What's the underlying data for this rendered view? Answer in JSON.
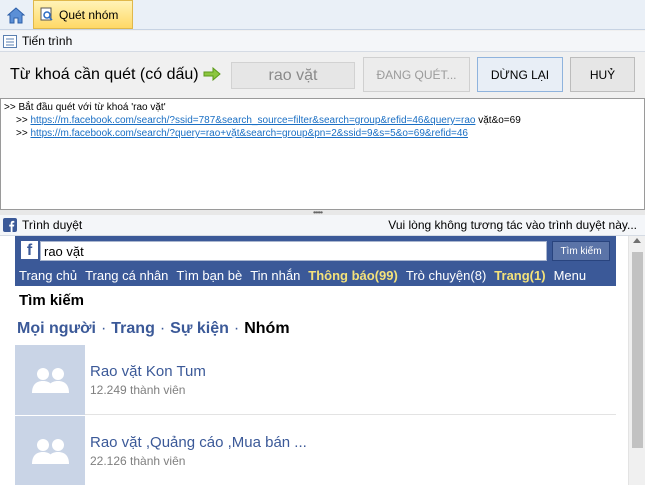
{
  "tabs": {
    "active_label": "Quét nhóm"
  },
  "progress_section": {
    "title": "Tiến trình"
  },
  "keyword": {
    "label": "Từ khoá cần quét (có dấu)",
    "value": "rao vặt",
    "scanning_button": "ĐANG QUÉT...",
    "stop_button": "DỪNG LẠI",
    "cancel_button": "HUỶ"
  },
  "log": {
    "lines": [
      {
        "prefix": ">> ",
        "text": "Bắt đầu quét với từ khoá 'rao vặt'",
        "link": "",
        "suffix": ""
      },
      {
        "prefix": ">> ",
        "text": "",
        "link": "https://m.facebook.com/search/?ssid=787&search_source=filter&search=group&refid=46&query=rao",
        "suffix": " vặt&o=69"
      },
      {
        "prefix": ">> ",
        "text": "",
        "link": "https://m.facebook.com/search/?query=rao+vặt&search=group&pn=2&ssid=9&s=5&o=69&refid=46",
        "suffix": ""
      }
    ]
  },
  "browser_section": {
    "title": "Trình duyệt",
    "note": "Vui lòng không tương tác vào trình duyệt này..."
  },
  "facebook": {
    "logo": "f",
    "search_value": "rao vặt",
    "search_button": "Tìm kiếm",
    "nav": [
      {
        "label": "Trang chủ",
        "highlight": false
      },
      {
        "label": "Trang cá nhân",
        "highlight": false
      },
      {
        "label": "Tìm bạn bè",
        "highlight": false
      },
      {
        "label": "Tin nhắn",
        "highlight": false
      },
      {
        "label": "Thông báo(99)",
        "highlight": true
      },
      {
        "label": "Trò chuyện(8)",
        "highlight": false
      },
      {
        "label": "Trang(1)",
        "highlight": true
      },
      {
        "label": "Menu",
        "highlight": false
      }
    ],
    "page_title": "Tìm kiếm",
    "filters": {
      "people": "Mọi người",
      "pages": "Trang",
      "events": "Sự kiện",
      "groups": "Nhóm",
      "separator": "·"
    },
    "groups": [
      {
        "name": "Rao vặt Kon Tum",
        "members": "12.249 thành viên"
      },
      {
        "name": "Rao vặt ,Quảng cáo ,Mua bán ...",
        "members": "22.126 thành viên"
      }
    ]
  },
  "colors": {
    "facebook_blue": "#3b5998",
    "notification_yellow": "#f4e27a",
    "link_blue": "#1a6fc4",
    "active_tab": "#ffd966"
  }
}
